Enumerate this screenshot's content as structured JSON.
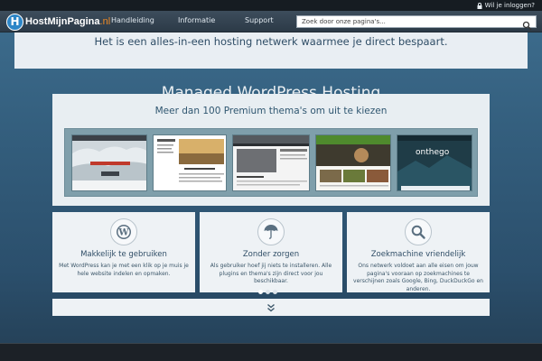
{
  "topbar": {
    "login_label": "Wil je inloggen?"
  },
  "logo": {
    "mark": "H",
    "name": "HostMijnPagina",
    "tld": ".nl"
  },
  "nav": {
    "items": [
      "Handleiding",
      "Informatie",
      "Support"
    ],
    "search_placeholder": "Zoek door onze pagina's..."
  },
  "tagline": "Het is een alles-in-een hosting netwerk waarmee je direct bespaart.",
  "hero": {
    "title": "Managed WordPress Hosting"
  },
  "themes": {
    "title": "Meer dan 100 Premium thema's om uit te kiezen",
    "thumbs": [
      "theme-preview-1",
      "theme-preview-2",
      "theme-preview-3",
      "theme-preview-4",
      "theme-preview-5"
    ],
    "thumb5_label": "onthego"
  },
  "features": [
    {
      "icon": "wordpress-icon",
      "title": "Makkelijk te gebruiken",
      "text": "Met WordPress kan je met een klik op je muis je hele website indelen en opmaken."
    },
    {
      "icon": "umbrella-icon",
      "title": "Zonder zorgen",
      "text": "Als gebruiker hoef jij niets te installeren. Alle plugins en thema's zijn direct voor jou beschikbaar."
    },
    {
      "icon": "search-icon",
      "title": "Zoekmachine vriendelijk",
      "text": "Ons netwerk voldoet aan alle eisen om jouw pagina's vooraan op zoekmachines te verschijnen zoals Google, Bing, DuckDuckGo en anderen."
    }
  ],
  "colors": {
    "accent": "#f08a24",
    "brand_blue": "#2d86c7",
    "panel": "#e9eef3",
    "text_dark": "#2f4d66"
  }
}
